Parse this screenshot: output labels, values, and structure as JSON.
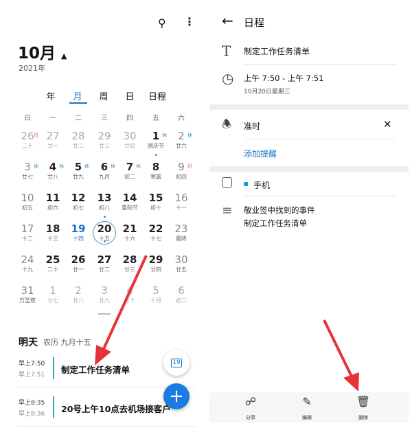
{
  "calendar": {
    "month_title": "10月",
    "year": "2021年",
    "views": [
      "年",
      "月",
      "周",
      "日",
      "日程"
    ],
    "active_view": "月",
    "weekdays": [
      "日",
      "一",
      "二",
      "三",
      "四",
      "五",
      "六"
    ],
    "weeks": [
      [
        {
          "d": "26",
          "l": "二十",
          "m": 1,
          "b": "班"
        },
        {
          "d": "27",
          "l": "廿一",
          "m": 1
        },
        {
          "d": "28",
          "l": "廿二",
          "m": 1
        },
        {
          "d": "29",
          "l": "廿三",
          "m": 1
        },
        {
          "d": "30",
          "l": "廿四",
          "m": 1
        },
        {
          "d": "1",
          "l": "国庆节",
          "b": "休",
          "dot": 1
        },
        {
          "d": "2",
          "l": "廿六",
          "b": "休"
        }
      ],
      [
        {
          "d": "3",
          "l": "廿七",
          "b": "休"
        },
        {
          "d": "4",
          "l": "廿八",
          "b": "休"
        },
        {
          "d": "5",
          "l": "廿九",
          "b": "休"
        },
        {
          "d": "6",
          "l": "九月",
          "b": "休"
        },
        {
          "d": "7",
          "l": "初二",
          "b": "休"
        },
        {
          "d": "8",
          "l": "寒露"
        },
        {
          "d": "9",
          "l": "初四",
          "b": "班"
        }
      ],
      [
        {
          "d": "10",
          "l": "初五"
        },
        {
          "d": "11",
          "l": "初六"
        },
        {
          "d": "12",
          "l": "初七"
        },
        {
          "d": "13",
          "l": "初八",
          "dot": 1
        },
        {
          "d": "14",
          "l": "重阳节"
        },
        {
          "d": "15",
          "l": "初十"
        },
        {
          "d": "16",
          "l": "十一"
        }
      ],
      [
        {
          "d": "17",
          "l": "十二"
        },
        {
          "d": "18",
          "l": "十三"
        },
        {
          "d": "19",
          "l": "十四",
          "today": 1
        },
        {
          "d": "20",
          "l": "十五",
          "sel": 1,
          "dot": 1
        },
        {
          "d": "21",
          "l": "十六"
        },
        {
          "d": "22",
          "l": "十七"
        },
        {
          "d": "23",
          "l": "霜降"
        }
      ],
      [
        {
          "d": "24",
          "l": "十九"
        },
        {
          "d": "25",
          "l": "二十"
        },
        {
          "d": "26",
          "l": "廿一"
        },
        {
          "d": "27",
          "l": "廿二"
        },
        {
          "d": "28",
          "l": "廿三"
        },
        {
          "d": "29",
          "l": "廿四"
        },
        {
          "d": "30",
          "l": "廿五"
        }
      ],
      [
        {
          "d": "31",
          "l": "万圣夜"
        },
        {
          "d": "1",
          "l": "廿七",
          "m": 1
        },
        {
          "d": "2",
          "l": "廿八",
          "m": 1
        },
        {
          "d": "3",
          "l": "廿九",
          "m": 1
        },
        {
          "d": "4",
          "l": "三十",
          "m": 1
        },
        {
          "d": "5",
          "l": "十月",
          "m": 1
        },
        {
          "d": "6",
          "l": "初二",
          "m": 1
        }
      ]
    ],
    "agenda_day": "明天",
    "agenda_lunar": "农历 九月十五",
    "events": [
      {
        "start": "早上7:50",
        "end": "早上7:51",
        "title": "制定工作任务清单"
      },
      {
        "start": "早上8:35",
        "end": "早上8:36",
        "title": "20号上午10点去机场接客户"
      }
    ],
    "today_fab": "19",
    "add_fab": "+"
  },
  "detail": {
    "title": "日程",
    "event_title": "制定工作任务清单",
    "time_range": "上午 7:50 - 上午 7:51",
    "date": "10月20日星期三",
    "reminder": "准时",
    "add_reminder": "添加提醒",
    "calendar_name": "手机",
    "notes_line1": "敬业签中找到的事件",
    "notes_line2": "制定工作任务清单",
    "toolbar": {
      "share": "分享",
      "edit": "编辑",
      "delete": "删除"
    }
  },
  "colors": {
    "accent": "#1a73c8",
    "fab": "#1a7be0",
    "arrow": "#e8323a",
    "event_bar": "#3aa7c9"
  }
}
